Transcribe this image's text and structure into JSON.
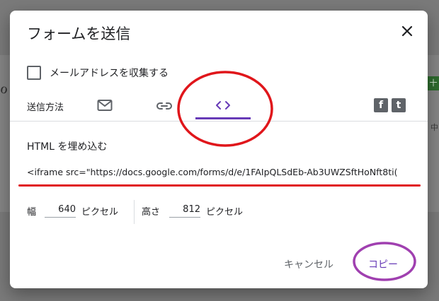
{
  "dialog": {
    "title": "フォームを送信",
    "collect_email_label": "メールアドレスを収集する",
    "send_via_label": "送信方法",
    "tabs": [
      {
        "icon": "email-icon"
      },
      {
        "icon": "link-icon"
      },
      {
        "icon": "embed-code-icon",
        "selected": true
      }
    ],
    "social": [
      {
        "icon": "facebook-icon",
        "glyph": "f"
      },
      {
        "icon": "twitter-icon",
        "glyph": "t"
      }
    ],
    "embed": {
      "section_label": "HTML を埋め込む",
      "code": "<iframe src=\"https://docs.google.com/forms/d/e/1FAIpQLSdEb-Ab3UWZSftHoNft8ti(",
      "width_label": "幅",
      "width_value": "640",
      "width_unit": "ピクセル",
      "height_label": "高さ",
      "height_value": "812",
      "height_unit": "ピクセル"
    },
    "buttons": {
      "cancel": "キャンセル",
      "copy": "コピー"
    }
  },
  "background": {
    "right_chip": "十",
    "right_glyph": "中"
  },
  "colors": {
    "accent": "#673ab7",
    "annotation_red": "#e0161b",
    "annotation_purple": "#a040b0"
  }
}
